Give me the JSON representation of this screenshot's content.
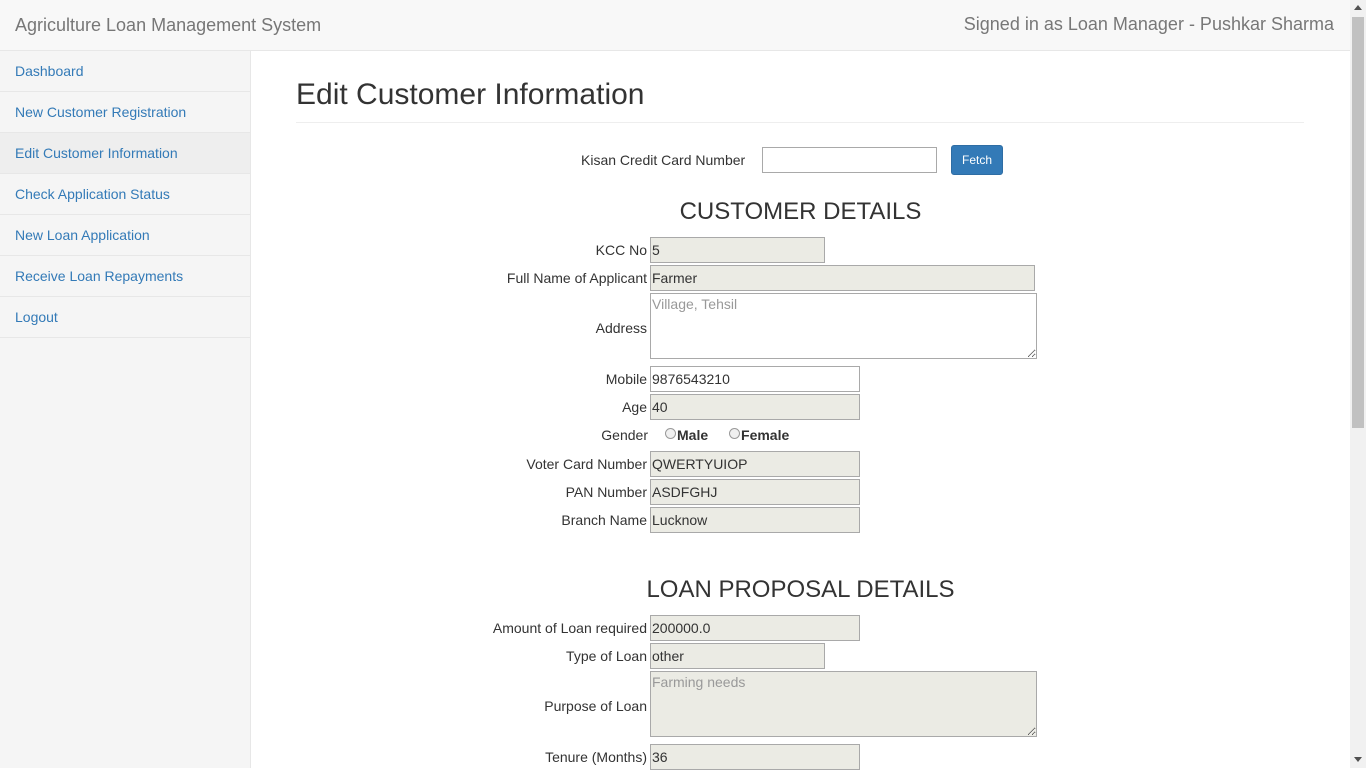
{
  "header": {
    "brand": "Agriculture Loan Management System",
    "signed_in": "Signed in as Loan Manager - Pushkar Sharma"
  },
  "sidebar": {
    "items": [
      {
        "label": "Dashboard",
        "active": false
      },
      {
        "label": "New Customer Registration",
        "active": false
      },
      {
        "label": "Edit Customer Information",
        "active": true
      },
      {
        "label": "Check Application Status",
        "active": false
      },
      {
        "label": "New Loan Application",
        "active": false
      },
      {
        "label": "Receive Loan Repayments",
        "active": false
      },
      {
        "label": "Logout",
        "active": false
      }
    ]
  },
  "main": {
    "title": "Edit Customer Information",
    "search": {
      "label": "Kisan Credit Card Number",
      "value": "",
      "button": "Fetch"
    },
    "customer": {
      "heading": "CUSTOMER DETAILS",
      "kcc": {
        "label": "KCC No",
        "value": "5"
      },
      "name": {
        "label": "Full Name of Applicant",
        "value": "Farmer"
      },
      "address": {
        "label": "Address",
        "value": "",
        "placeholder": "Village, Tehsil"
      },
      "mobile": {
        "label": "Mobile",
        "value": "9876543210"
      },
      "age": {
        "label": "Age",
        "value": "40"
      },
      "gender": {
        "label": "Gender",
        "options": [
          "Male",
          "Female"
        ],
        "selected": null
      },
      "voter": {
        "label": "Voter Card Number",
        "value": "QWERTYUIOP"
      },
      "pan": {
        "label": "PAN Number",
        "value": "ASDFGHJ"
      },
      "branch": {
        "label": "Branch Name",
        "value": "Lucknow"
      }
    },
    "loan": {
      "heading": "LOAN PROPOSAL DETAILS",
      "amount": {
        "label": "Amount of Loan required",
        "value": "200000.0"
      },
      "type": {
        "label": "Type of Loan",
        "value": "other"
      },
      "purpose": {
        "label": "Purpose of Loan",
        "value": "",
        "placeholder": "Farming needs"
      },
      "tenure": {
        "label": "Tenure (Months)",
        "value": "36"
      }
    }
  },
  "colors": {
    "link": "#337ab7",
    "button": "#337ab7",
    "readonly_field": "#ebebe4",
    "navbar": "#f8f8f8"
  }
}
